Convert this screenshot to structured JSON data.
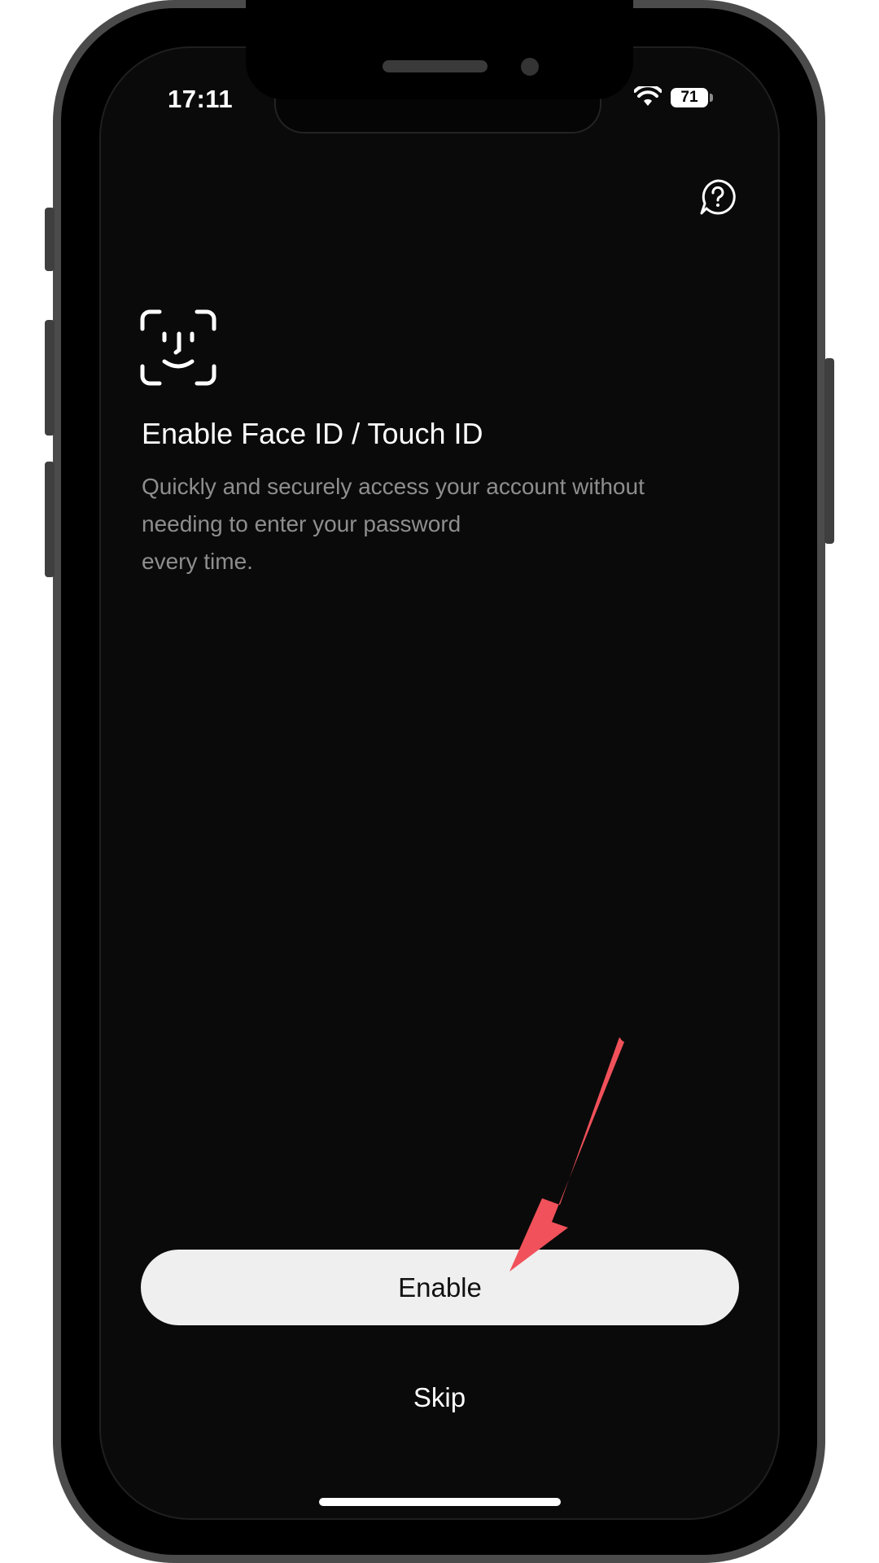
{
  "status_bar": {
    "time": "17:11",
    "battery": "71",
    "icons": [
      "wifi-icon",
      "battery-icon"
    ]
  },
  "header": {
    "help_icon": "question-chat-icon"
  },
  "content": {
    "icon": "face-id-icon",
    "title": "Enable Face ID / Touch ID",
    "description_lines": [
      "Quickly and securely access your account without",
      "needing to enter your password",
      "every time."
    ]
  },
  "actions": {
    "enable_label": "Enable",
    "skip_label": "Skip"
  },
  "annotation": {
    "arrow_color": "#f0515a",
    "arrow_target": "enable-button"
  },
  "colors": {
    "background": "#0a0a0a",
    "primary_button": "#efefef",
    "text": "#ffffff",
    "secondary_text": "#8e8e8e"
  }
}
